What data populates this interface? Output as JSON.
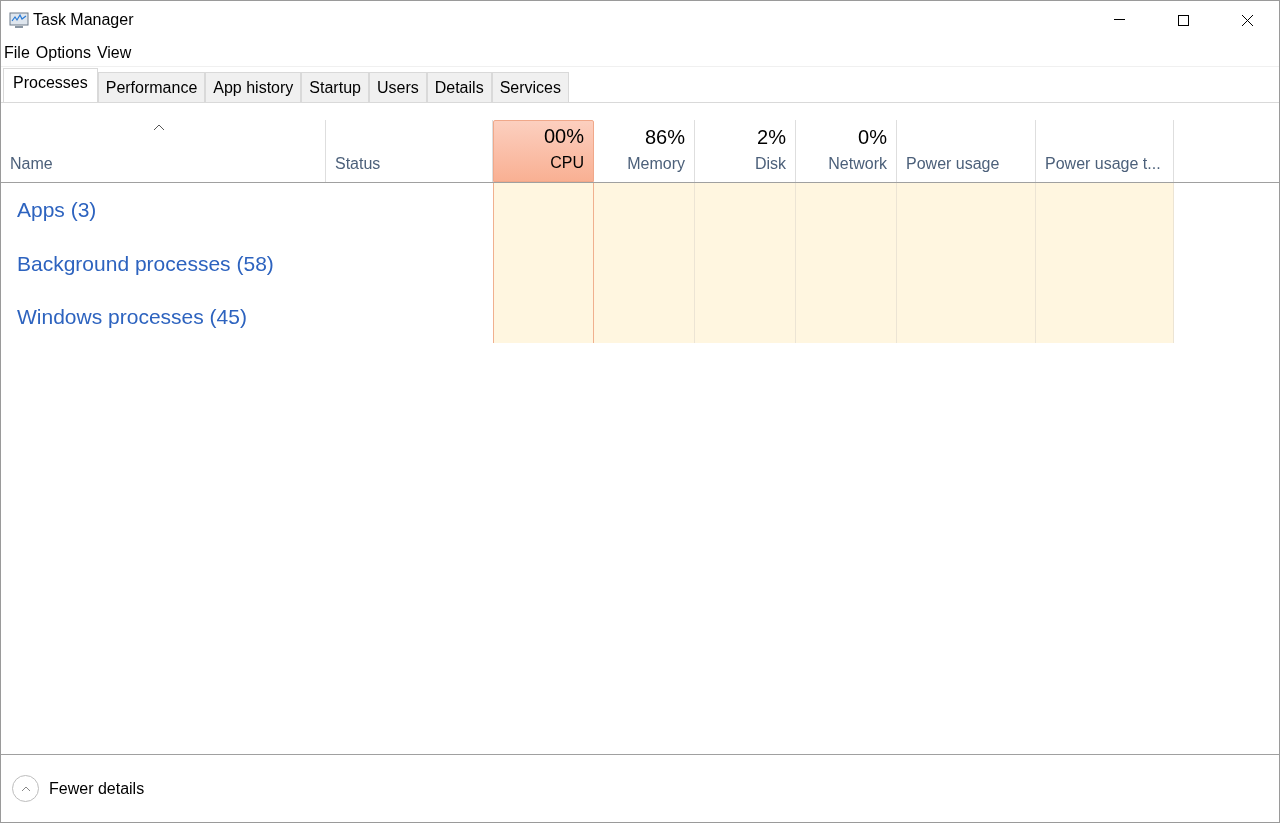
{
  "window": {
    "title": "Task Manager"
  },
  "menu": [
    "File",
    "Options",
    "View"
  ],
  "tabs": [
    {
      "label": "Processes",
      "selected": true
    },
    {
      "label": "Performance",
      "selected": false
    },
    {
      "label": "App history",
      "selected": false
    },
    {
      "label": "Startup",
      "selected": false
    },
    {
      "label": "Users",
      "selected": false
    },
    {
      "label": "Details",
      "selected": false
    },
    {
      "label": "Services",
      "selected": false
    }
  ],
  "columns": [
    {
      "label": "Name",
      "kind": "name",
      "sorted": true
    },
    {
      "label": "Status",
      "kind": "text",
      "sorted": false
    },
    {
      "label": "CPU",
      "kind": "metric",
      "value": "00%",
      "color": "#fff6e0",
      "highlighted": true,
      "sorted": false
    },
    {
      "label": "Memory",
      "kind": "metric",
      "value": "86%",
      "color": "#fff6e0",
      "highlighted": false,
      "sorted": false
    },
    {
      "label": "Disk",
      "kind": "metric",
      "value": "2%",
      "color": "#fff6e0",
      "highlighted": false,
      "sorted": false
    },
    {
      "label": "Network",
      "kind": "metric",
      "value": "0%",
      "color": "#fff6e0",
      "highlighted": false,
      "sorted": false
    },
    {
      "label": "Power usage",
      "kind": "text-metric",
      "color": "#fff6e0",
      "sorted": false
    },
    {
      "label": "Power usage t...",
      "kind": "text-metric",
      "color": "#fff6e0",
      "sorted": false
    }
  ],
  "groups": [
    "Apps (3)",
    "Background processes (58)",
    "Windows processes (45)"
  ],
  "footer": {
    "label": "Fewer details"
  }
}
